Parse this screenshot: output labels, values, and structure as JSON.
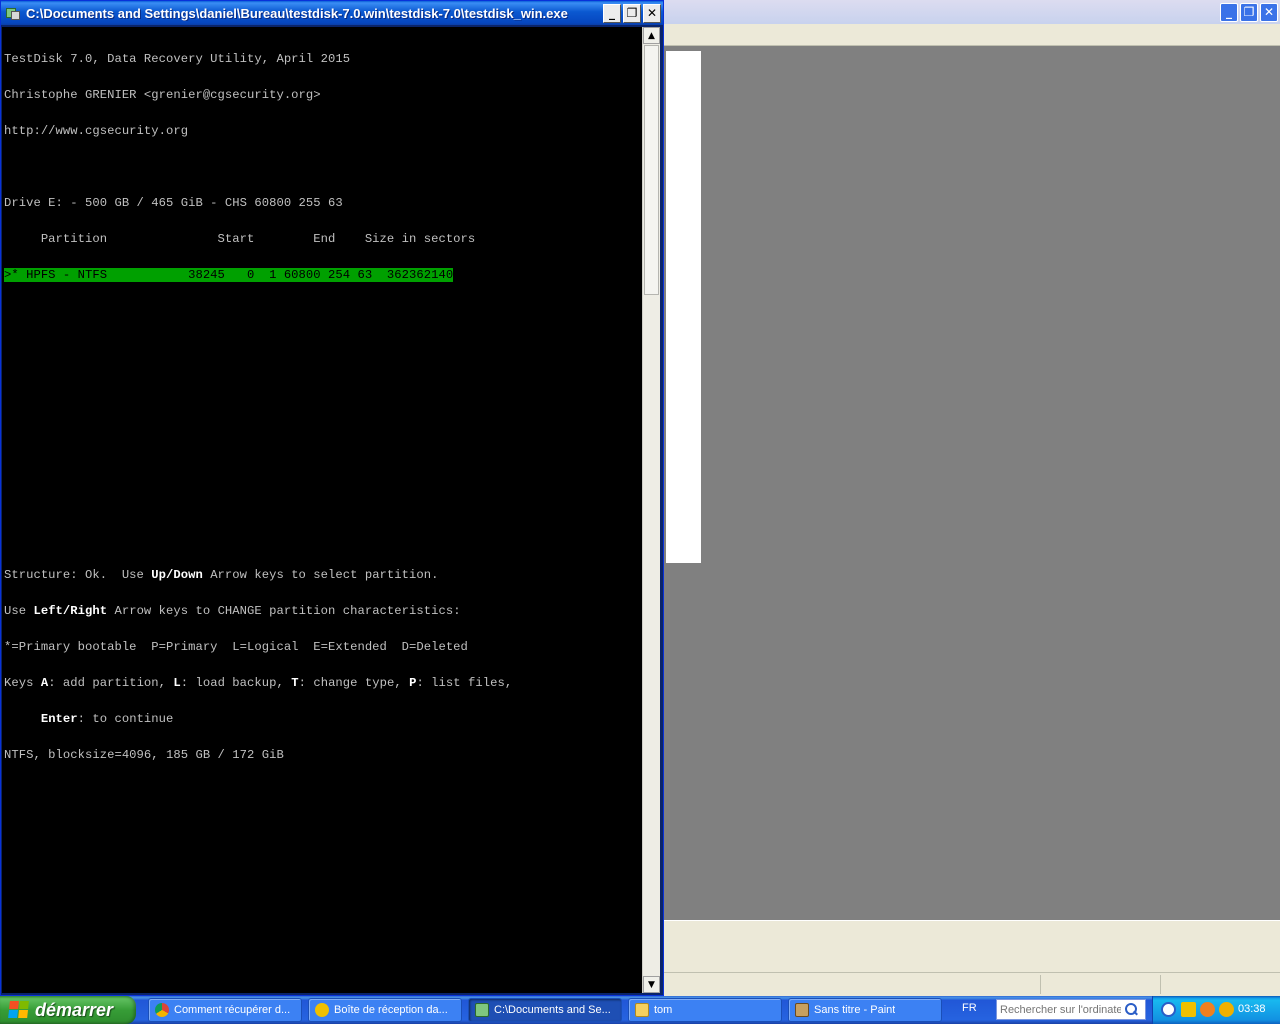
{
  "console": {
    "title": "C:\\Documents and Settings\\daniel\\Bureau\\testdisk-7.0.win\\testdisk-7.0\\testdisk_win.exe",
    "lines": {
      "l1": "TestDisk 7.0, Data Recovery Utility, April 2015",
      "l2": "Christophe GRENIER <grenier@cgsecurity.org>",
      "l3": "http://www.cgsecurity.org",
      "l5": "Drive E: - 500 GB / 465 GiB - CHS 60800 255 63",
      "l6": "     Partition               Start        End    Size in sectors",
      "l7": ">* HPFS - NTFS           38245   0  1 60800 254 63  362362140",
      "s1a": "Structure: Ok.  Use ",
      "s1b": "Up/Down",
      "s1c": " Arrow keys to select partition.",
      "s2a": "Use ",
      "s2b": "Left/Right",
      "s2c": " Arrow keys to CHANGE partition characteristics:",
      "s3": "*=Primary bootable  P=Primary  L=Logical  E=Extended  D=Deleted",
      "s4a": "Keys ",
      "s4b": "A",
      "s4c": ": add partition, ",
      "s4d": "L",
      "s4e": ": load backup, ",
      "s4f": "T",
      "s4g": ": change type, ",
      "s4h": "P",
      "s4i": ": list files,",
      "s5a": "     ",
      "s5b": "Enter",
      "s5c": ": to continue",
      "s6": "NTFS, blocksize=4096, 185 GB / 172 GiB"
    }
  },
  "window_buttons": {
    "minimize": "_",
    "restore": "❐",
    "close": "✕"
  },
  "taskbar": {
    "start_label": "démarrer",
    "tasks": [
      {
        "label": "Comment récupérer d...",
        "icon_color": "#e8b010"
      },
      {
        "label": "Boîte de réception da...",
        "icon_color": "#f0c000"
      },
      {
        "label": "C:\\Documents and Se...",
        "icon_color": "#7fc77f"
      },
      {
        "label": "tom",
        "icon_color": "#f4d060"
      },
      {
        "label": "Sans titre - Paint",
        "icon_color": "#c8a060"
      }
    ],
    "language": "FR",
    "search_placeholder": "Rechercher sur l'ordinateur",
    "clock": "03:38"
  },
  "colors": {
    "selection_bg": "#00a000",
    "taskbar_blue": "#2663e0",
    "start_green": "#379d37"
  }
}
